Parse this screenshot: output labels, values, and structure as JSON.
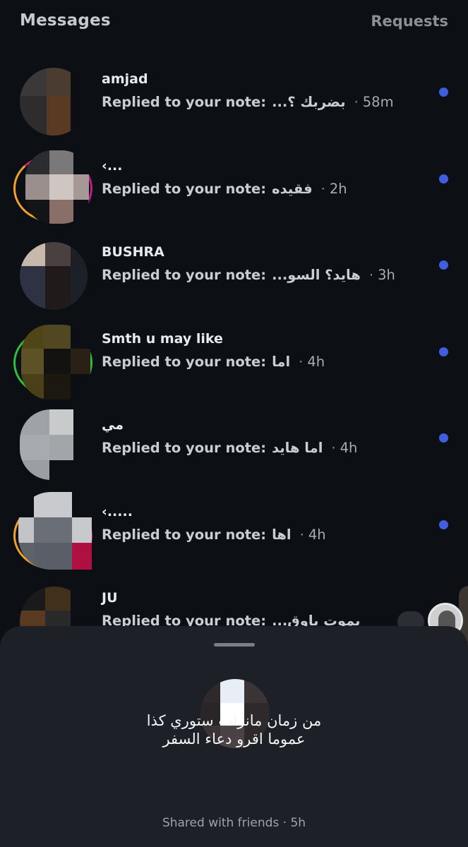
{
  "header": {
    "title": "Messages",
    "requests_label": "Requests"
  },
  "threads": [
    {
      "name": "amjad",
      "prefix": "Replied to your note:",
      "note": "بضربك ؟...",
      "time": "58m",
      "unread": true
    },
    {
      "name": "‹...",
      "prefix": "Replied to your note:",
      "note": "فقيده",
      "time": "2h",
      "unread": true
    },
    {
      "name": "BUSHRA",
      "prefix": "Replied to your note:",
      "note": "هايد؟ السو...",
      "time": "3h",
      "unread": true
    },
    {
      "name": "Smth u may like",
      "prefix": "Replied to your note:",
      "note": "اما",
      "time": "4h",
      "unread": true
    },
    {
      "name": "مي",
      "prefix": "Replied to your note:",
      "note": "اما هايد",
      "time": "4h",
      "unread": true
    },
    {
      "name": "‹.....",
      "prefix": "Replied to your note:",
      "note": "اها",
      "time": "4h",
      "unread": true
    },
    {
      "name": "JU",
      "prefix": "Replied to your note:",
      "note": "بموت باوق...",
      "time": "",
      "unread": false
    }
  ],
  "note_sheet": {
    "text_line1": "من زمان مانزلت ستوري كذا",
    "text_line2": "عموما اقرو دعاء السفر",
    "meta": "Shared with friends · 5h"
  },
  "colors": {
    "unread_dot": "#3f5ee0",
    "ring_green": "#2fbf3a",
    "ring_gradient": [
      "#f0a22a",
      "#d6246e",
      "#8b2bd2"
    ]
  },
  "icons": {
    "unread": "unread-dot-icon",
    "sheet_handle": "drag-handle-icon"
  }
}
